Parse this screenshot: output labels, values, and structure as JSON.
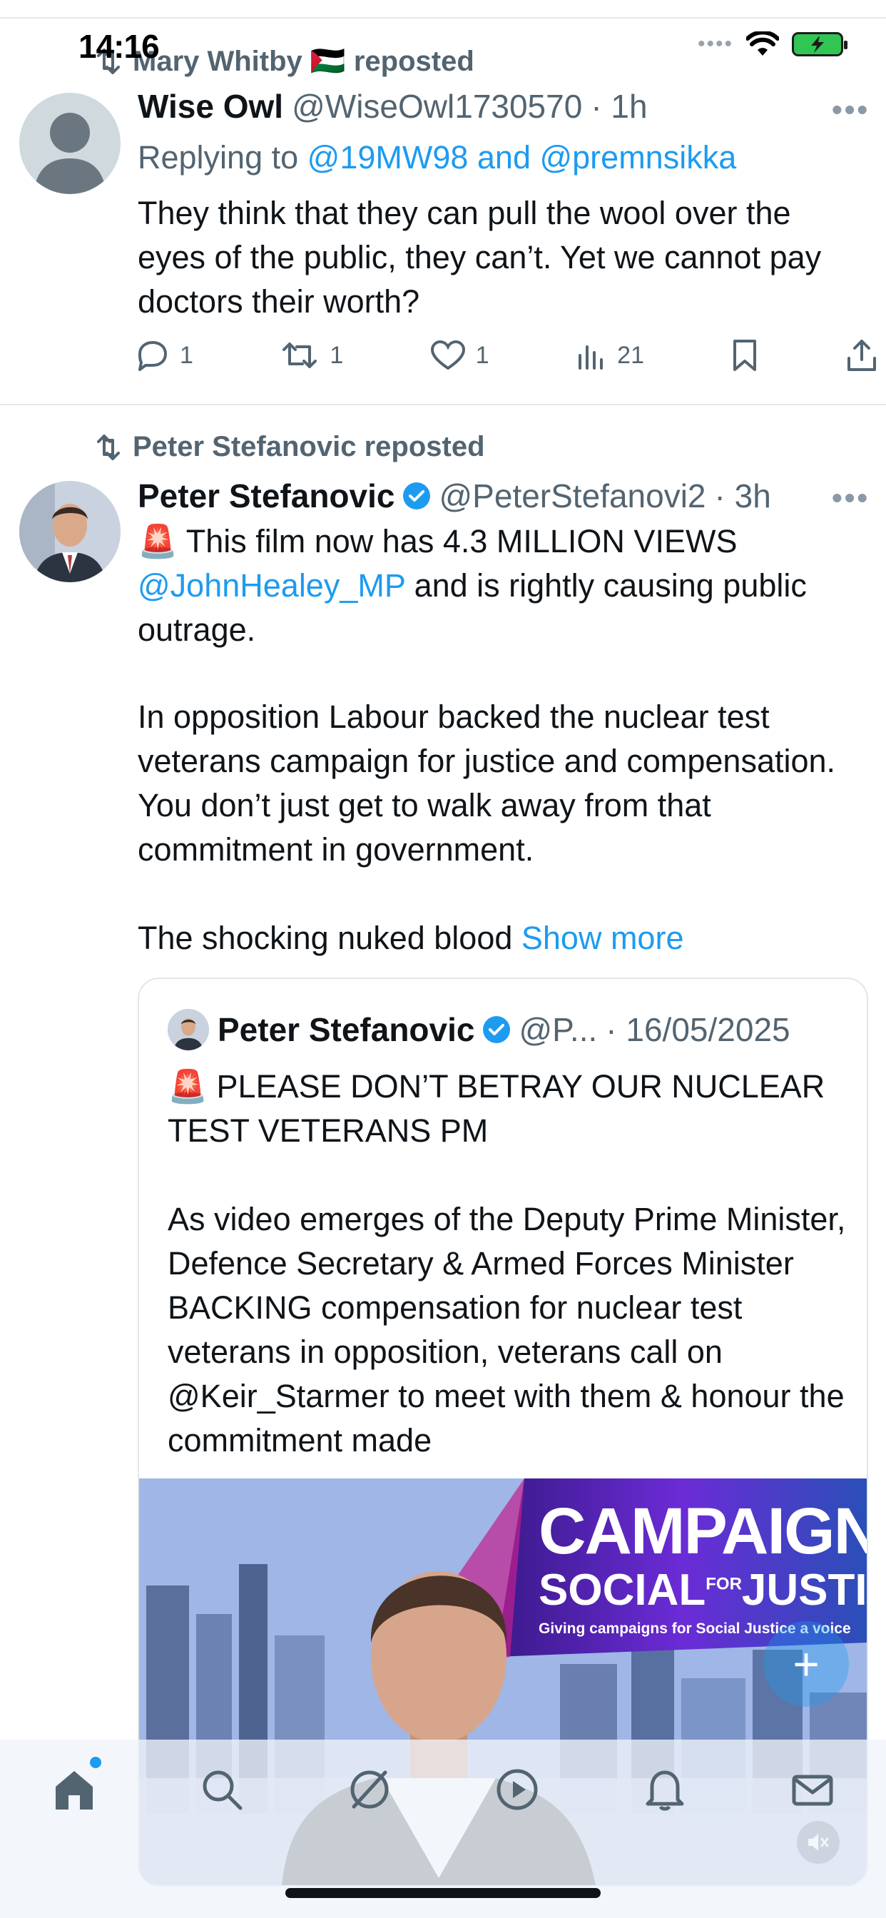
{
  "status_bar": {
    "time": "14:16"
  },
  "posts": [
    {
      "repost_by": "Mary Whitby 🇵🇸 reposted",
      "name": "Wise Owl",
      "handle": "@WiseOwl1730570",
      "time": "· 1h",
      "reply_prefix": "Replying to ",
      "reply_targets": "@19MW98 and @premnsikka",
      "text": "They think that they can pull the wool over the eyes of the public, they can’t. Yet we cannot pay doctors their worth?",
      "stats": {
        "replies": "1",
        "reposts": "1",
        "likes": "1",
        "views": "21"
      }
    },
    {
      "repost_by": "Peter Stefanovic reposted",
      "name": "Peter Stefanovic",
      "handle": "@PeterStefanovi2",
      "time": "· 3h",
      "emoji": "🚨",
      "text_1": " This film now has 4.3 MILLION VIEWS",
      "mention": "@JohnHealey_MP",
      "text_2": " and is rightly causing public outrage.",
      "paragraph_2": "In opposition Labour backed the nuclear test veterans campaign for justice and compensation. You don’t just get to walk away from that commitment in government.",
      "paragraph_3": "The shocking nuked blood ",
      "show_more": "Show more",
      "quote": {
        "name": "Peter Stefanovic",
        "handle": "@P...",
        "date": "· 16/05/2025",
        "emoji": "🚨",
        "line_1": " PLEASE DON’T BETRAY OUR NUCLEAR TEST VETERANS PM",
        "paragraph_2": "As video emerges of the Deputy Prime Minister, Defence Secretary & Armed Forces Minister BACKING compensation for nuclear test veterans in opposition, veterans call on @Keir_Starmer to meet with them & honour the commitment made",
        "media": {
          "banner_line_1": "CAMPAIGN",
          "banner_line_2": "SOCIAL",
          "banner_for": "FOR",
          "banner_line_3": "JUSTICE",
          "banner_tagline": "Giving campaigns for Social Justice a voice"
        }
      }
    }
  ],
  "colors": {
    "accent": "#1d9bf0",
    "text": "#0f1419",
    "muted": "#536471"
  },
  "nav": [
    "home-icon",
    "search-icon",
    "grok-icon",
    "video-icon",
    "notifications-icon",
    "messages-icon"
  ]
}
